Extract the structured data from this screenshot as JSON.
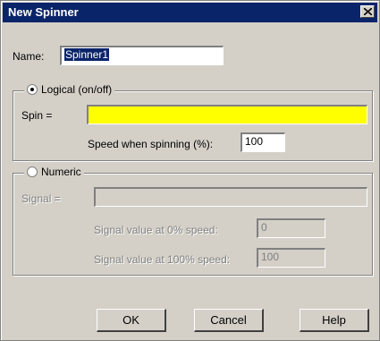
{
  "dialog": {
    "title": "New Spinner"
  },
  "name_field": {
    "label": "Name:",
    "value": "Spinner1"
  },
  "logical_group": {
    "option_label": "Logical (on/off)",
    "selected": true,
    "spin_label": "Spin =",
    "spin_value": "",
    "spin_color": "#ffff00",
    "speed_label": "Speed when spinning (%):",
    "speed_value": "100"
  },
  "numeric_group": {
    "option_label": "Numeric",
    "selected": false,
    "signal_label": "Signal =",
    "signal_value": "",
    "zero_label": "Signal value at 0% speed:",
    "zero_value": "0",
    "hundred_label": "Signal value at 100% speed:",
    "hundred_value": "100"
  },
  "buttons": {
    "ok": "OK",
    "cancel": "Cancel",
    "help": "Help"
  },
  "icons": {
    "close": "close-icon"
  },
  "colors": {
    "titlebar": "#0a246a",
    "face": "#d4d0c8"
  }
}
